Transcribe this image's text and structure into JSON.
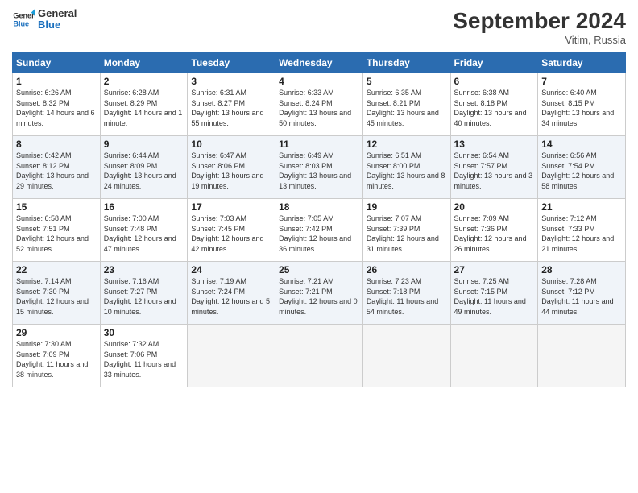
{
  "header": {
    "logo_line1": "General",
    "logo_line2": "Blue",
    "month": "September 2024",
    "location": "Vitim, Russia"
  },
  "days_of_week": [
    "Sunday",
    "Monday",
    "Tuesday",
    "Wednesday",
    "Thursday",
    "Friday",
    "Saturday"
  ],
  "weeks": [
    [
      {
        "day": "1",
        "sunrise": "Sunrise: 6:26 AM",
        "sunset": "Sunset: 8:32 PM",
        "daylight": "Daylight: 14 hours and 6 minutes."
      },
      {
        "day": "2",
        "sunrise": "Sunrise: 6:28 AM",
        "sunset": "Sunset: 8:29 PM",
        "daylight": "Daylight: 14 hours and 1 minute."
      },
      {
        "day": "3",
        "sunrise": "Sunrise: 6:31 AM",
        "sunset": "Sunset: 8:27 PM",
        "daylight": "Daylight: 13 hours and 55 minutes."
      },
      {
        "day": "4",
        "sunrise": "Sunrise: 6:33 AM",
        "sunset": "Sunset: 8:24 PM",
        "daylight": "Daylight: 13 hours and 50 minutes."
      },
      {
        "day": "5",
        "sunrise": "Sunrise: 6:35 AM",
        "sunset": "Sunset: 8:21 PM",
        "daylight": "Daylight: 13 hours and 45 minutes."
      },
      {
        "day": "6",
        "sunrise": "Sunrise: 6:38 AM",
        "sunset": "Sunset: 8:18 PM",
        "daylight": "Daylight: 13 hours and 40 minutes."
      },
      {
        "day": "7",
        "sunrise": "Sunrise: 6:40 AM",
        "sunset": "Sunset: 8:15 PM",
        "daylight": "Daylight: 13 hours and 34 minutes."
      }
    ],
    [
      {
        "day": "8",
        "sunrise": "Sunrise: 6:42 AM",
        "sunset": "Sunset: 8:12 PM",
        "daylight": "Daylight: 13 hours and 29 minutes."
      },
      {
        "day": "9",
        "sunrise": "Sunrise: 6:44 AM",
        "sunset": "Sunset: 8:09 PM",
        "daylight": "Daylight: 13 hours and 24 minutes."
      },
      {
        "day": "10",
        "sunrise": "Sunrise: 6:47 AM",
        "sunset": "Sunset: 8:06 PM",
        "daylight": "Daylight: 13 hours and 19 minutes."
      },
      {
        "day": "11",
        "sunrise": "Sunrise: 6:49 AM",
        "sunset": "Sunset: 8:03 PM",
        "daylight": "Daylight: 13 hours and 13 minutes."
      },
      {
        "day": "12",
        "sunrise": "Sunrise: 6:51 AM",
        "sunset": "Sunset: 8:00 PM",
        "daylight": "Daylight: 13 hours and 8 minutes."
      },
      {
        "day": "13",
        "sunrise": "Sunrise: 6:54 AM",
        "sunset": "Sunset: 7:57 PM",
        "daylight": "Daylight: 13 hours and 3 minutes."
      },
      {
        "day": "14",
        "sunrise": "Sunrise: 6:56 AM",
        "sunset": "Sunset: 7:54 PM",
        "daylight": "Daylight: 12 hours and 58 minutes."
      }
    ],
    [
      {
        "day": "15",
        "sunrise": "Sunrise: 6:58 AM",
        "sunset": "Sunset: 7:51 PM",
        "daylight": "Daylight: 12 hours and 52 minutes."
      },
      {
        "day": "16",
        "sunrise": "Sunrise: 7:00 AM",
        "sunset": "Sunset: 7:48 PM",
        "daylight": "Daylight: 12 hours and 47 minutes."
      },
      {
        "day": "17",
        "sunrise": "Sunrise: 7:03 AM",
        "sunset": "Sunset: 7:45 PM",
        "daylight": "Daylight: 12 hours and 42 minutes."
      },
      {
        "day": "18",
        "sunrise": "Sunrise: 7:05 AM",
        "sunset": "Sunset: 7:42 PM",
        "daylight": "Daylight: 12 hours and 36 minutes."
      },
      {
        "day": "19",
        "sunrise": "Sunrise: 7:07 AM",
        "sunset": "Sunset: 7:39 PM",
        "daylight": "Daylight: 12 hours and 31 minutes."
      },
      {
        "day": "20",
        "sunrise": "Sunrise: 7:09 AM",
        "sunset": "Sunset: 7:36 PM",
        "daylight": "Daylight: 12 hours and 26 minutes."
      },
      {
        "day": "21",
        "sunrise": "Sunrise: 7:12 AM",
        "sunset": "Sunset: 7:33 PM",
        "daylight": "Daylight: 12 hours and 21 minutes."
      }
    ],
    [
      {
        "day": "22",
        "sunrise": "Sunrise: 7:14 AM",
        "sunset": "Sunset: 7:30 PM",
        "daylight": "Daylight: 12 hours and 15 minutes."
      },
      {
        "day": "23",
        "sunrise": "Sunrise: 7:16 AM",
        "sunset": "Sunset: 7:27 PM",
        "daylight": "Daylight: 12 hours and 10 minutes."
      },
      {
        "day": "24",
        "sunrise": "Sunrise: 7:19 AM",
        "sunset": "Sunset: 7:24 PM",
        "daylight": "Daylight: 12 hours and 5 minutes."
      },
      {
        "day": "25",
        "sunrise": "Sunrise: 7:21 AM",
        "sunset": "Sunset: 7:21 PM",
        "daylight": "Daylight: 12 hours and 0 minutes."
      },
      {
        "day": "26",
        "sunrise": "Sunrise: 7:23 AM",
        "sunset": "Sunset: 7:18 PM",
        "daylight": "Daylight: 11 hours and 54 minutes."
      },
      {
        "day": "27",
        "sunrise": "Sunrise: 7:25 AM",
        "sunset": "Sunset: 7:15 PM",
        "daylight": "Daylight: 11 hours and 49 minutes."
      },
      {
        "day": "28",
        "sunrise": "Sunrise: 7:28 AM",
        "sunset": "Sunset: 7:12 PM",
        "daylight": "Daylight: 11 hours and 44 minutes."
      }
    ],
    [
      {
        "day": "29",
        "sunrise": "Sunrise: 7:30 AM",
        "sunset": "Sunset: 7:09 PM",
        "daylight": "Daylight: 11 hours and 38 minutes."
      },
      {
        "day": "30",
        "sunrise": "Sunrise: 7:32 AM",
        "sunset": "Sunset: 7:06 PM",
        "daylight": "Daylight: 11 hours and 33 minutes."
      },
      null,
      null,
      null,
      null,
      null
    ]
  ]
}
